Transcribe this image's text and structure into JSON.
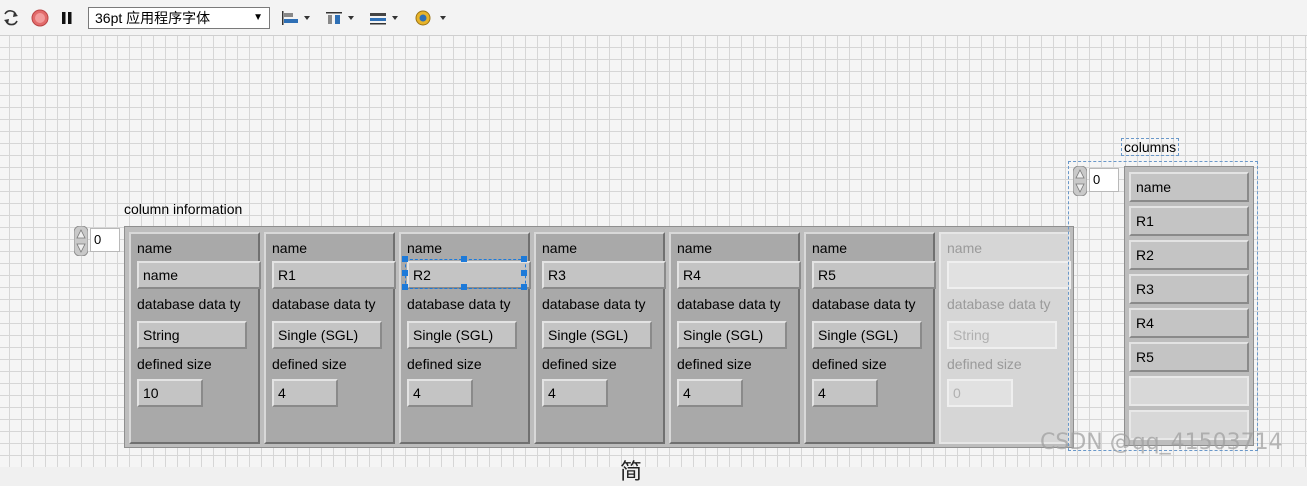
{
  "toolbar": {
    "font_select": "36pt 应用程序字体",
    "icons": [
      "run-continuous-icon",
      "abort-icon",
      "pause-icon",
      "align-objects-icon",
      "distribute-objects-icon",
      "resize-objects-icon",
      "reorder-icon"
    ]
  },
  "column_information": {
    "label": "column information",
    "index_value": "0",
    "clusters": [
      {
        "name_label": "name",
        "name_value": "name",
        "type_label": "database data ty",
        "type_value": "String",
        "size_label": "defined size",
        "size_value": "10",
        "faded": false
      },
      {
        "name_label": "name",
        "name_value": "R1",
        "type_label": "database data ty",
        "type_value": "Single (SGL)",
        "size_label": "defined size",
        "size_value": "4",
        "faded": false
      },
      {
        "name_label": "name",
        "name_value": "R2",
        "type_label": "database data ty",
        "type_value": "Single (SGL)",
        "size_label": "defined size",
        "size_value": "4",
        "faded": false
      },
      {
        "name_label": "name",
        "name_value": "R3",
        "type_label": "database data ty",
        "type_value": "Single (SGL)",
        "size_label": "defined size",
        "size_value": "4",
        "faded": false
      },
      {
        "name_label": "name",
        "name_value": "R4",
        "type_label": "database data ty",
        "type_value": "Single (SGL)",
        "size_label": "defined size",
        "size_value": "4",
        "faded": false
      },
      {
        "name_label": "name",
        "name_value": "R5",
        "type_label": "database data ty",
        "type_value": "Single (SGL)",
        "size_label": "defined size",
        "size_value": "4",
        "faded": false
      },
      {
        "name_label": "name",
        "name_value": "",
        "type_label": "database data ty",
        "type_value": "String",
        "size_label": "defined size",
        "size_value": "0",
        "faded": true
      }
    ]
  },
  "columns": {
    "label": "columns",
    "index_value": "0",
    "items": [
      "name",
      "R1",
      "R2",
      "R3",
      "R4",
      "R5",
      "",
      ""
    ]
  },
  "watermark": "CSDN @qq_41503714",
  "bottom_glyph": "简"
}
